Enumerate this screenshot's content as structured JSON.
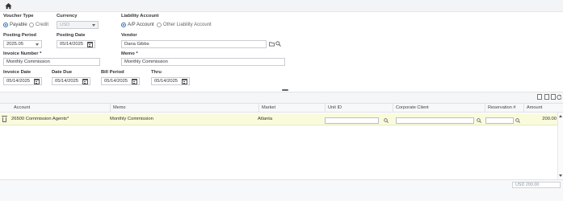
{
  "topbar": {
    "home_icon": "home-icon"
  },
  "voucher_type": {
    "label": "Voucher Type",
    "options": [
      "Payable",
      "Credit"
    ],
    "selected": "Payable"
  },
  "currency": {
    "label": "Currency",
    "value": "USD"
  },
  "liability_account": {
    "label": "Liability Account",
    "options": [
      "A/P Account",
      "Other Liability Account"
    ],
    "selected": "A/P Account"
  },
  "posting_period": {
    "label": "Posting Period",
    "value": "2025.05"
  },
  "posting_date": {
    "label": "Posting Date",
    "value": "05/14/2025"
  },
  "vendor": {
    "label": "Vendor",
    "value": "Dana Gibbs"
  },
  "invoice_number": {
    "label": "Invoice Number *",
    "value": "Monthly Commission"
  },
  "memo": {
    "label": "Memo *",
    "value": "Monthly Commission"
  },
  "invoice_date": {
    "label": "Invoice Date",
    "value": "05/14/2025"
  },
  "date_due": {
    "label": "Date Due",
    "value": "05/14/2025"
  },
  "bill_period": {
    "label": "Bill Period",
    "value": "05/14/2025"
  },
  "thru": {
    "label": "Thru",
    "value": "05/14/2025"
  },
  "grid": {
    "columns": [
      "Account",
      "Memo",
      "Market",
      "Unit ID",
      "Corporate Client",
      "Reservation #",
      "Amount"
    ],
    "rows": [
      {
        "account": "26500 Commission Agents*",
        "memo": "Monthly Commission",
        "market": "Atlanta",
        "unit_id": "",
        "corporate_client": "",
        "reservation": "",
        "amount": "200.00"
      }
    ]
  },
  "footer": {
    "total": "USD 200.00"
  }
}
